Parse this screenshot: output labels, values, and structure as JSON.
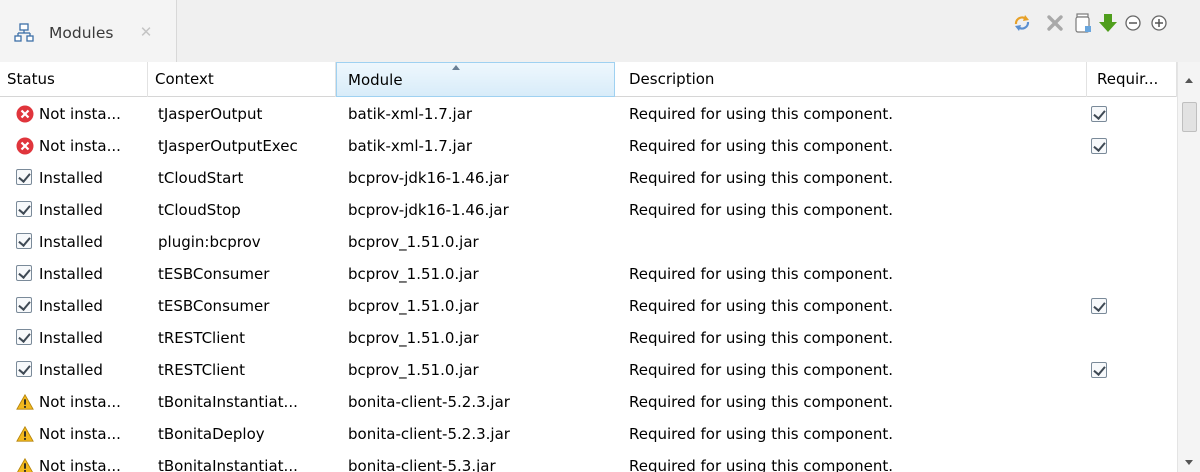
{
  "view_tab": {
    "label": "Modules",
    "icon": "modules-tree-icon",
    "close_icon": "close-icon"
  },
  "toolbar": {
    "buttons": [
      {
        "name": "refresh-button",
        "icon": "refresh-icon"
      },
      {
        "name": "remove-button",
        "icon": "remove-icon"
      },
      {
        "name": "import-button",
        "icon": "import-jar-icon"
      },
      {
        "name": "download-button",
        "icon": "download-arrow-icon"
      },
      {
        "name": "collapse-button",
        "icon": "minus-circle-icon"
      },
      {
        "name": "expand-button",
        "icon": "plus-circle-icon"
      }
    ]
  },
  "table": {
    "columns": {
      "status": "Status",
      "context": "Context",
      "module": "Module",
      "description": "Description",
      "required": "Requir..."
    },
    "sorted_column": "Module",
    "rows": [
      {
        "status_icon": "error",
        "status": "Not insta...",
        "context": "tJasperOutput",
        "module": "batik-xml-1.7.jar",
        "description": "Required for using this component.",
        "required": true
      },
      {
        "status_icon": "error",
        "status": "Not insta...",
        "context": "tJasperOutputExec",
        "module": "batik-xml-1.7.jar",
        "description": "Required for using this component.",
        "required": true
      },
      {
        "status_icon": "checkbox",
        "status": "Installed",
        "context": "tCloudStart",
        "module": "bcprov-jdk16-1.46.jar",
        "description": "Required for using this component.",
        "required": false
      },
      {
        "status_icon": "checkbox",
        "status": "Installed",
        "context": "tCloudStop",
        "module": "bcprov-jdk16-1.46.jar",
        "description": "Required for using this component.",
        "required": false
      },
      {
        "status_icon": "checkbox",
        "status": "Installed",
        "context": "plugin:bcprov",
        "module": "bcprov_1.51.0.jar",
        "description": "",
        "required": false
      },
      {
        "status_icon": "checkbox",
        "status": "Installed",
        "context": "tESBConsumer",
        "module": "bcprov_1.51.0.jar",
        "description": "Required for using this component.",
        "required": false
      },
      {
        "status_icon": "checkbox",
        "status": "Installed",
        "context": "tESBConsumer",
        "module": "bcprov_1.51.0.jar",
        "description": "Required for using this component.",
        "required": true
      },
      {
        "status_icon": "checkbox",
        "status": "Installed",
        "context": "tRESTClient",
        "module": "bcprov_1.51.0.jar",
        "description": "Required for using this component.",
        "required": false
      },
      {
        "status_icon": "checkbox",
        "status": "Installed",
        "context": "tRESTClient",
        "module": "bcprov_1.51.0.jar",
        "description": "Required for using this component.",
        "required": true
      },
      {
        "status_icon": "warning",
        "status": "Not insta...",
        "context": "tBonitaInstantiat...",
        "module": "bonita-client-5.2.3.jar",
        "description": "Required for using this component.",
        "required": false
      },
      {
        "status_icon": "warning",
        "status": "Not insta...",
        "context": "tBonitaDeploy",
        "module": "bonita-client-5.2.3.jar",
        "description": "Required for using this component.",
        "required": false
      },
      {
        "status_icon": "warning",
        "status": "Not insta...",
        "context": "tBonitaInstantiat...",
        "module": "bonita-client-5.3.jar",
        "description": "Required for using this component.",
        "required": false
      }
    ]
  },
  "colors": {
    "error": "#e0353c",
    "warning": "#f2b81d",
    "download_arrow": "#4f9e1c",
    "refresh": "#e7a128",
    "sorted_header": "#d8ecf9"
  }
}
